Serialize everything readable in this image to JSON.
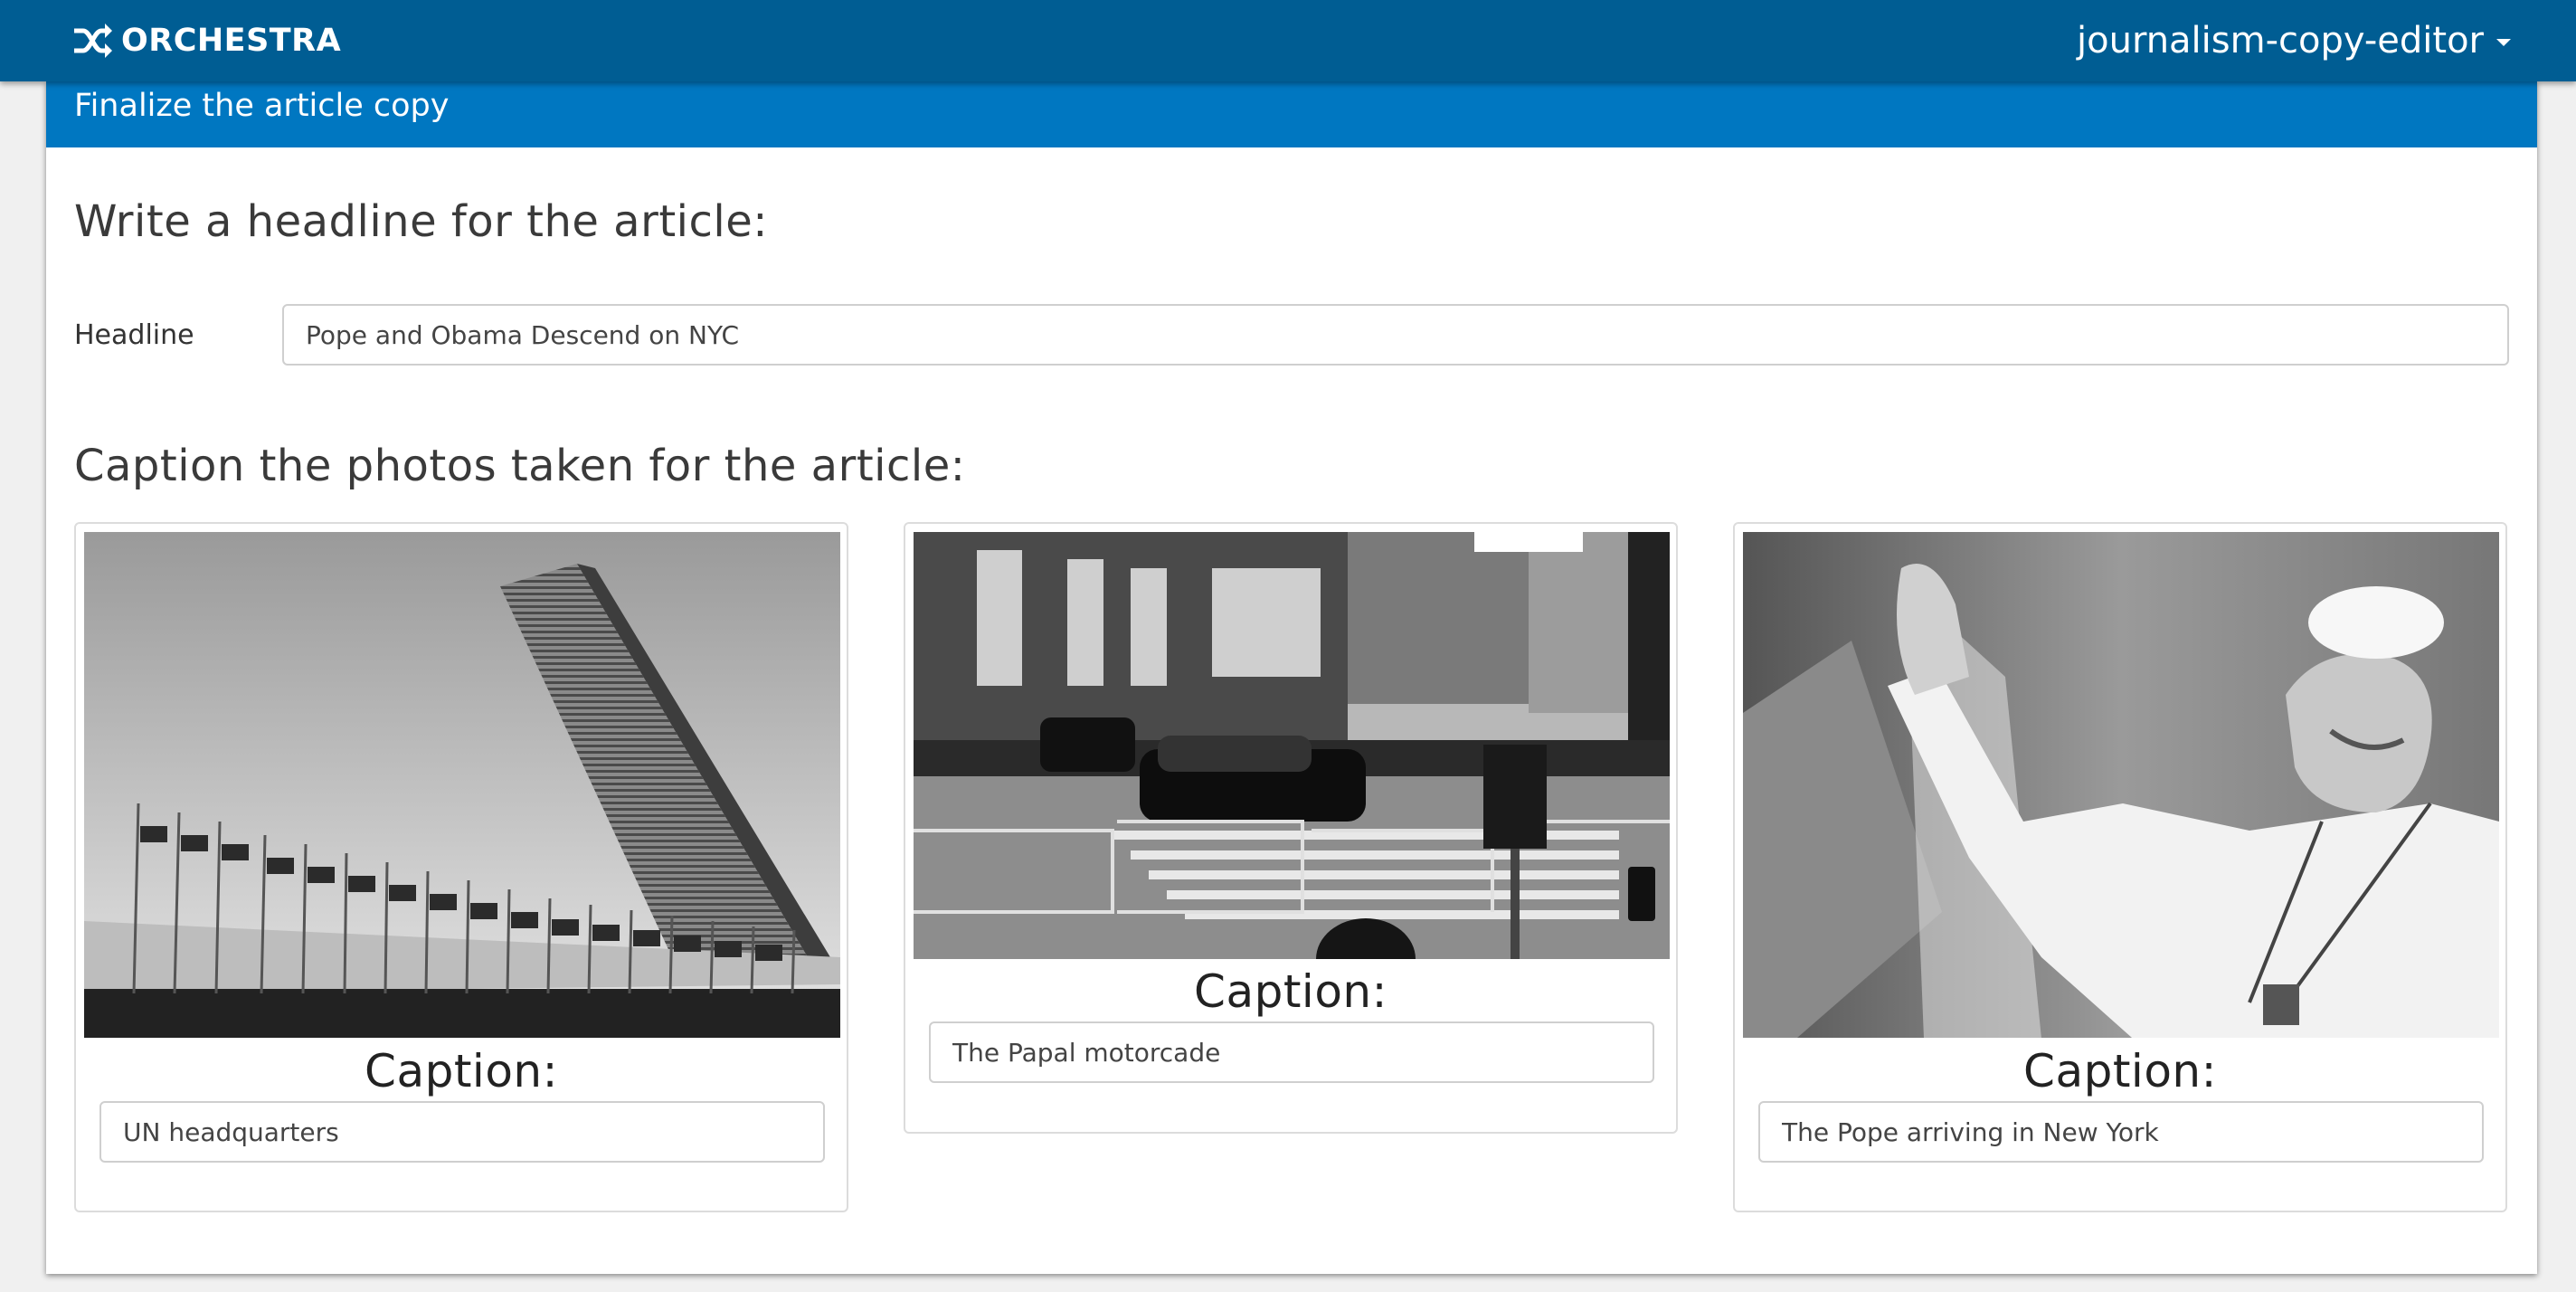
{
  "app": {
    "brand": "ORCHESTRA",
    "brand_icon": "shuffle-icon",
    "user_menu_label": "journalism-copy-editor"
  },
  "task": {
    "title": "Finalize the article copy",
    "headline_section_title": "Write a headline for the article:",
    "headline_label": "Headline",
    "headline_value": "Pope and Obama Descend on NYC",
    "captions_section_title": "Caption the photos taken for the article:",
    "photos": [
      {
        "caption_label": "Caption:",
        "caption_value": "UN headquarters"
      },
      {
        "caption_label": "Caption:",
        "caption_value": "The Papal motorcade"
      },
      {
        "caption_label": "Caption:",
        "caption_value": "The Pope arriving in New York"
      }
    ]
  },
  "colors": {
    "topbar": "#005d93",
    "panel_heading": "#0077c1",
    "page_background": "#f0f0f0"
  }
}
